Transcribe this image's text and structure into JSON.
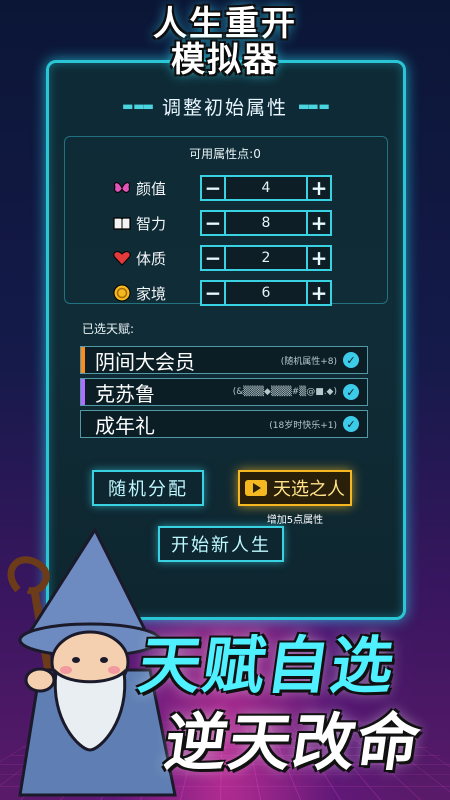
{
  "header": {
    "title_line1": "人生重开",
    "title_line2": "模拟器",
    "subtitle": "调整初始属性"
  },
  "points": {
    "text": "可用属性点:0"
  },
  "attributes": [
    {
      "icon": "butterfly-icon",
      "label": "颜值",
      "value": "4"
    },
    {
      "icon": "book-icon",
      "label": "智力",
      "value": "8"
    },
    {
      "icon": "heart-icon",
      "label": "体质",
      "value": "2"
    },
    {
      "icon": "coin-icon",
      "label": "家境",
      "value": "6"
    }
  ],
  "stepper": {
    "minus": "−",
    "plus": "+"
  },
  "talents": {
    "label": "已选天赋:",
    "items": [
      {
        "name": "阴间大会员",
        "desc": "(随机属性+8)",
        "color": "#ff8a1c"
      },
      {
        "name": "克苏鲁",
        "desc": "(&▒▒▒◆▒▒▒#▒@■.◆)",
        "color": "#b26cff"
      },
      {
        "name": "成年礼",
        "desc": "(18岁时快乐+1)",
        "color": "#0b1e26"
      }
    ]
  },
  "buttons": {
    "random": "随机分配",
    "pick": "天选之人",
    "pick_sub": "增加5点属性",
    "start": "开始新人生"
  },
  "slogan": {
    "line1": "天赋自选",
    "line2": "逆天改命"
  },
  "colors": {
    "accent": "#38d2e2",
    "gold": "#f5b820",
    "check": "#3ccbe8"
  }
}
